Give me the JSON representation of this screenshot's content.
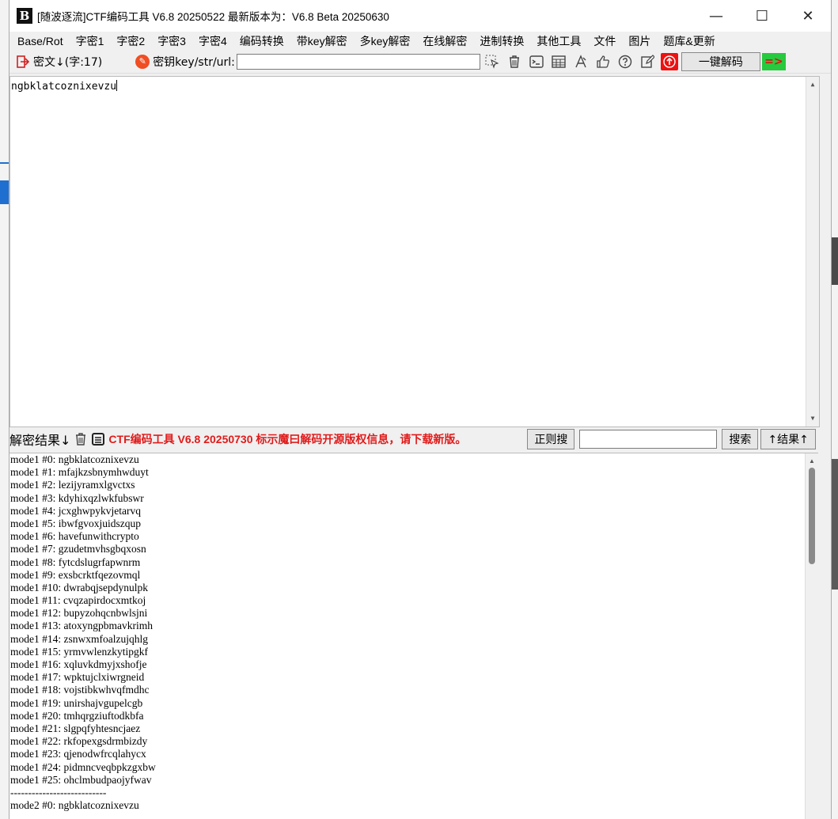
{
  "window": {
    "title": "[随波逐流]CTF编码工具 V6.8 20250522     最新版本为：V6.8 Beta 20250630",
    "logo": "B",
    "minimize": "—",
    "maximize": "☐",
    "close": "✕"
  },
  "menu": [
    "Base/Rot",
    "字密1",
    "字密2",
    "字密3",
    "字密4",
    "编码转换",
    "带key解密",
    "多key解密",
    "在线解密",
    "进制转换",
    "其他工具",
    "文件",
    "图片",
    "题库&更新"
  ],
  "toolbar": {
    "ciphertext_label": "密文↓(字:17)",
    "key_label": "密钥key/str/url:",
    "key_value": "",
    "decode_label": "一键解码",
    "arrow_label": "=>"
  },
  "cipher": {
    "text": "ngbklatcoznixevzu"
  },
  "results_bar": {
    "label": "解密结果↓",
    "marquee": "CTF编码工具 V6.8 20250730 标示魔曰解码开源版权信息，请下载新版。",
    "regex_label": "正则搜",
    "search_value": "",
    "search_label": "搜索",
    "result_up_label": "↑结果↑"
  },
  "results": [
    "mode1 #0: ngbklatcoznixevzu",
    "mode1 #1: mfajkzsbnymhwduyt",
    "mode1 #2: lezijyramxlgvctxs",
    "mode1 #3: kdyhixqzlwkfubswr",
    "mode1 #4: jcxghwpykvjetarvq",
    "mode1 #5: ibwfgvoxjuidszqup",
    "mode1 #6: havefunwithcrypto",
    "mode1 #7: gzudetmvhsgbqxosn",
    "mode1 #8: fytcdslugrfapwnrm",
    "mode1 #9: exsbcrktfqezovmql",
    "mode1 #10: dwrabqjsepdynulpk",
    "mode1 #11: cvqzapirdocxmtkoj",
    "mode1 #12: bupyzohqcnbwlsjni",
    "mode1 #13: atoxyngpbmavkrimh",
    "mode1 #14: zsnwxmfoalzujqhlg",
    "mode1 #15: yrmvwlenzkytipgkf",
    "mode1 #16: xqluvkdmyjxshofje",
    "mode1 #17: wpktujclxiwrgneid",
    "mode1 #18: vojstibkwhvqfmdhc",
    "mode1 #19: unirshajvgupelcgb",
    "mode1 #20: tmhqrgziuftodkbfa",
    "mode1 #21: slgpqfyhtesncjaez",
    "mode1 #22: rkfopexgsdrmbizdy",
    "mode1 #23: qjenodwfrcqlahycx",
    "mode1 #24: pidmncvеqbpkzgxbw",
    "mode1 #25: ohclmbudpaojyfwav",
    "---------------------------",
    "mode2 #0: ngbklatcoznixevzu"
  ],
  "icons": [
    "decrypt-arrow-icon",
    "key-icon",
    "pointer-icon",
    "trash-icon",
    "terminal-icon",
    "table-icon",
    "font-icon",
    "thumb-up-icon",
    "help-icon",
    "edit-icon",
    "upload-icon"
  ],
  "colors": {
    "marquee": "#e01b1b",
    "upload_bg": "#ee1111",
    "arrow_bg": "#27c93f"
  }
}
